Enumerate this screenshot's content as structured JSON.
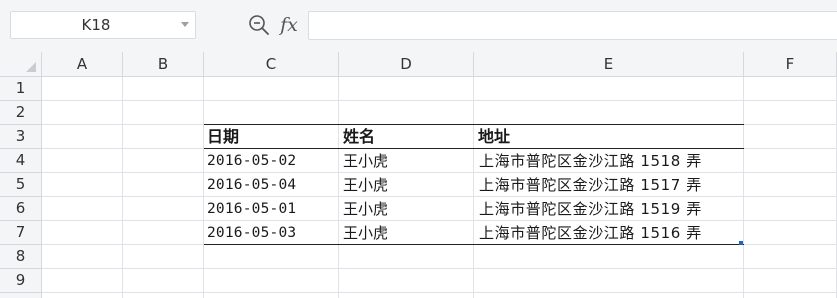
{
  "formula_bar": {
    "name_box": "K18",
    "fx_label": "fx",
    "formula": ""
  },
  "columns": [
    "A",
    "B",
    "C",
    "D",
    "E",
    "F"
  ],
  "rows": [
    "1",
    "2",
    "3",
    "4",
    "5",
    "6",
    "7",
    "8",
    "9"
  ],
  "table": {
    "headers": [
      "日期",
      "姓名",
      "地址"
    ],
    "records": [
      {
        "date": "2016-05-02",
        "name": "王小虎",
        "address": "上海市普陀区金沙江路 1518 弄"
      },
      {
        "date": "2016-05-04",
        "name": "王小虎",
        "address": "上海市普陀区金沙江路 1517 弄"
      },
      {
        "date": "2016-05-01",
        "name": "王小虎",
        "address": "上海市普陀区金沙江路 1519 弄"
      },
      {
        "date": "2016-05-03",
        "name": "王小虎",
        "address": "上海市普陀区金沙江路 1516 弄"
      }
    ]
  },
  "colors": {
    "accent": "#1e63c8",
    "header_bg": "#f3f5f7",
    "gridline": "#dfe3e8"
  }
}
